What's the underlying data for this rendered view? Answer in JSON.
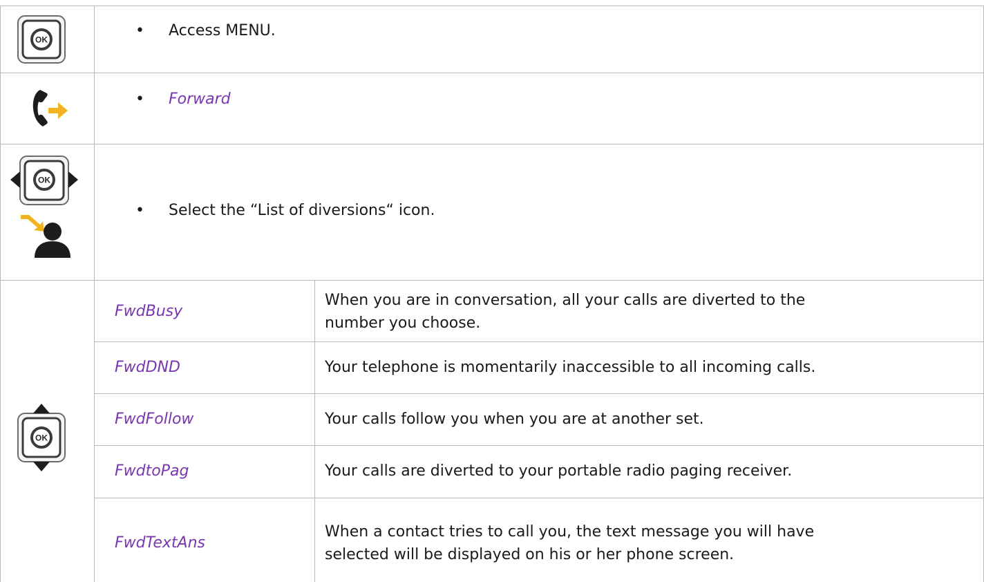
{
  "steps": [
    {
      "icon": "ok-button-icon",
      "text": "Access MENU.",
      "style": "normal"
    },
    {
      "icon": "forward-phone-icon",
      "text": "Forward",
      "style": "option"
    },
    {
      "icon": "ok-left-right-navigation-icon",
      "icon2": "diversion-user-icon",
      "text": "Select the “List of diversions“ icon.",
      "style": "normal"
    }
  ],
  "options_icon": "ok-up-down-navigation-icon",
  "options": [
    {
      "name": "FwdBusy",
      "description_lines": [
        "When you are in conversation, all your calls are diverted to the",
        "number you choose."
      ]
    },
    {
      "name": "FwdDND",
      "description_lines": [
        "Your telephone is momentarily inaccessible to all incoming calls."
      ]
    },
    {
      "name": "FwdFollow",
      "description_lines": [
        "Your calls follow you when you are at another set."
      ]
    },
    {
      "name": "FwdtoPag",
      "description_lines": [
        "Your calls are diverted to your portable radio paging receiver."
      ]
    },
    {
      "name": "FwdTextAns",
      "description_lines": [
        "When a contact tries to call you, the text message you will have",
        "selected will be displayed on his or her phone screen."
      ]
    }
  ],
  "colors": {
    "option_text": "#7a35b0",
    "grid": "#b9b9b9",
    "arrow_orange": "#f0b020"
  }
}
